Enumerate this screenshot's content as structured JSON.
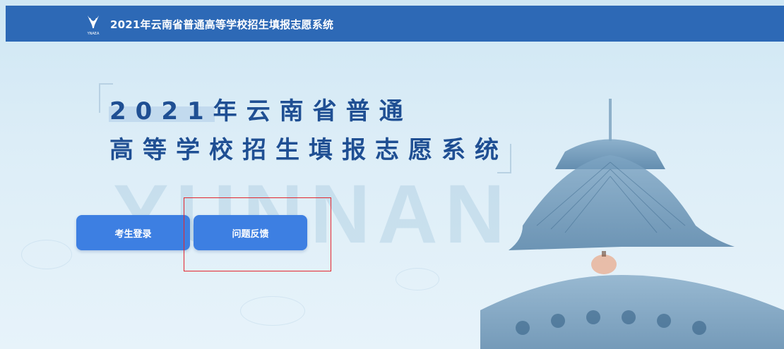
{
  "header": {
    "logo_text": "YNAEA",
    "title": "2021年云南省普通高等学校招生填报志愿系统"
  },
  "hero": {
    "line1": "2021年云南省普通",
    "line2": "高等学校招生填报志愿系统",
    "watermark": "YUNNAN"
  },
  "buttons": {
    "login": "考生登录",
    "feedback": "问题反馈"
  },
  "colors": {
    "topbar": "#2d69b6",
    "button": "#3d7fe2",
    "headline": "#1f4f93",
    "annotation": "#e3262e"
  }
}
